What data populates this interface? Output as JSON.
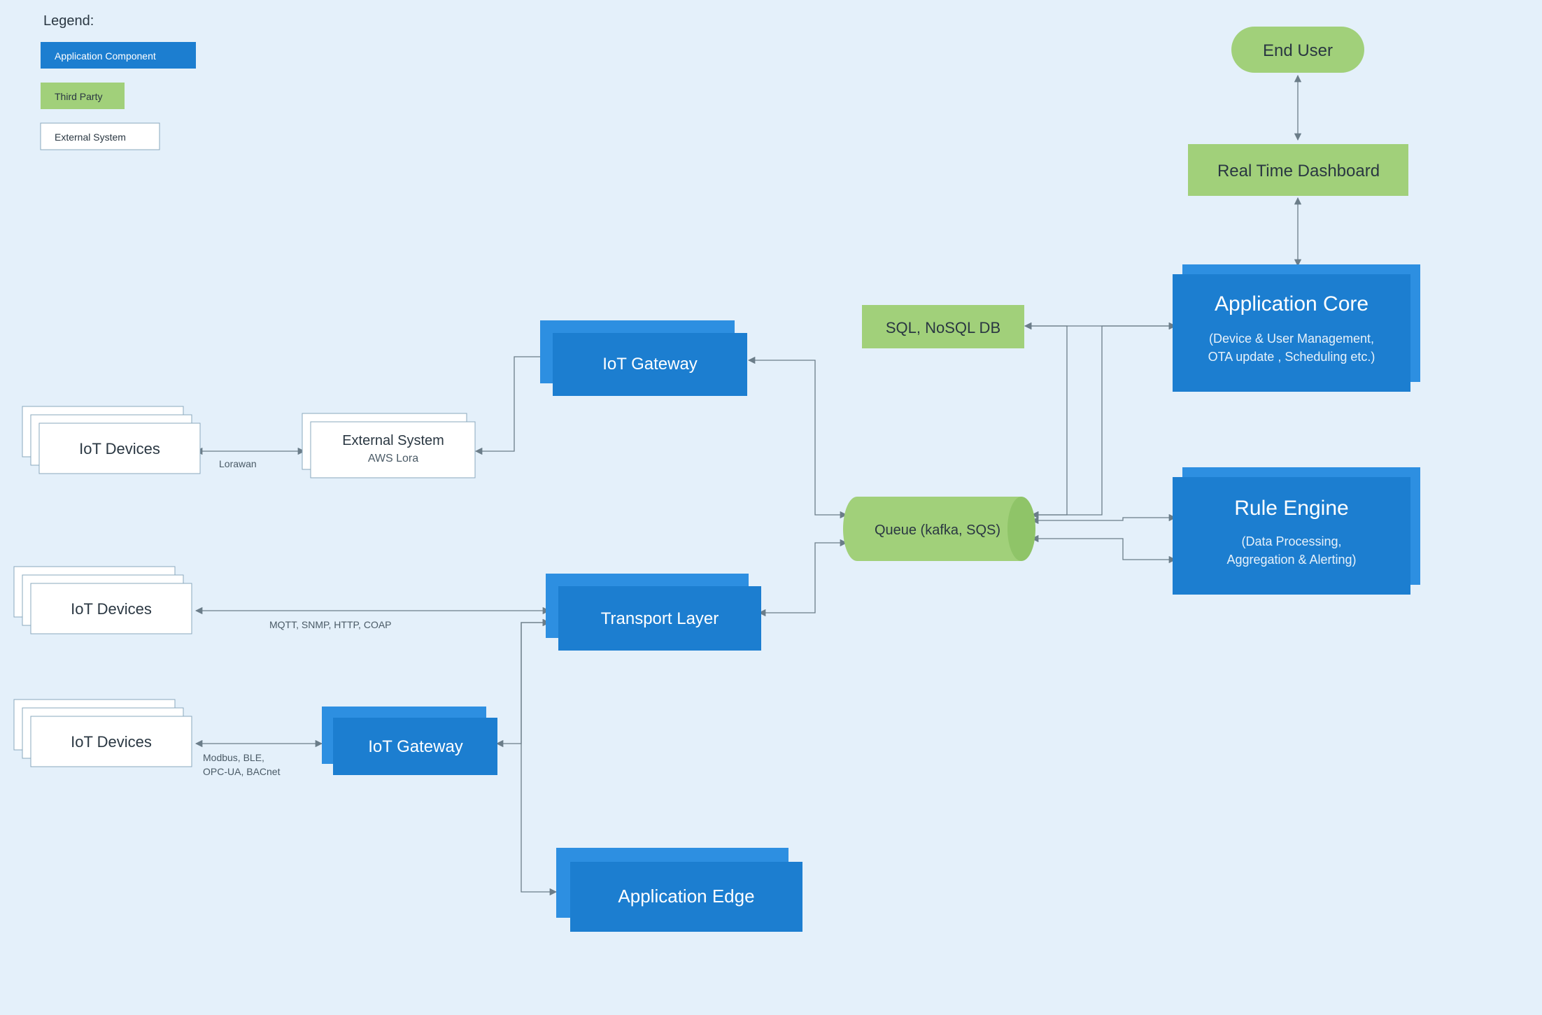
{
  "legend": {
    "title": "Legend:",
    "items": [
      {
        "label": "Application Component",
        "fill": "#1c7ed0",
        "textClass": "legend-label-light"
      },
      {
        "label": "Third Party",
        "fill": "#a1d07a",
        "textClass": "legend-label-dark"
      },
      {
        "label": "External System",
        "fill": "#ffffff",
        "textClass": "legend-label-dark"
      }
    ]
  },
  "nodes": {
    "iotDevices1": {
      "title": "IoT Devices"
    },
    "iotDevices2": {
      "title": "IoT Devices"
    },
    "iotDevices3": {
      "title": "IoT Devices"
    },
    "externalSystem": {
      "title": "External System",
      "subtitle": "AWS Lora"
    },
    "iotGateway1": {
      "title": "IoT Gateway"
    },
    "iotGateway2": {
      "title": "IoT Gateway"
    },
    "transportLayer": {
      "title": "Transport Layer"
    },
    "applicationEdge": {
      "title": "Application Edge"
    },
    "queue": {
      "title": "Queue (kafka, SQS)"
    },
    "sqlDb": {
      "title": "SQL, NoSQL DB"
    },
    "appCore": {
      "title": "Application Core",
      "subtitle1": "(Device & User Management,",
      "subtitle2": "OTA update , Scheduling etc.)"
    },
    "ruleEngine": {
      "title": "Rule Engine",
      "subtitle1": "(Data Processing,",
      "subtitle2": "Aggregation & Alerting)"
    },
    "dashboard": {
      "title": "Real Time Dashboard"
    },
    "endUser": {
      "title": "End User"
    }
  },
  "edgeLabels": {
    "lorawan": "Lorawan",
    "mqtt": "MQTT, SNMP, HTTP, COAP",
    "modbus1": "Modbus, BLE,",
    "modbus2": "OPC-UA, BACnet"
  },
  "colors": {
    "blue": "#1c7ed0",
    "blueLight": "#2d8fe1",
    "green": "#a1d07a",
    "greenDark": "#8fc468",
    "bg": "#e4f0fa",
    "edge": "#6b7d89"
  }
}
